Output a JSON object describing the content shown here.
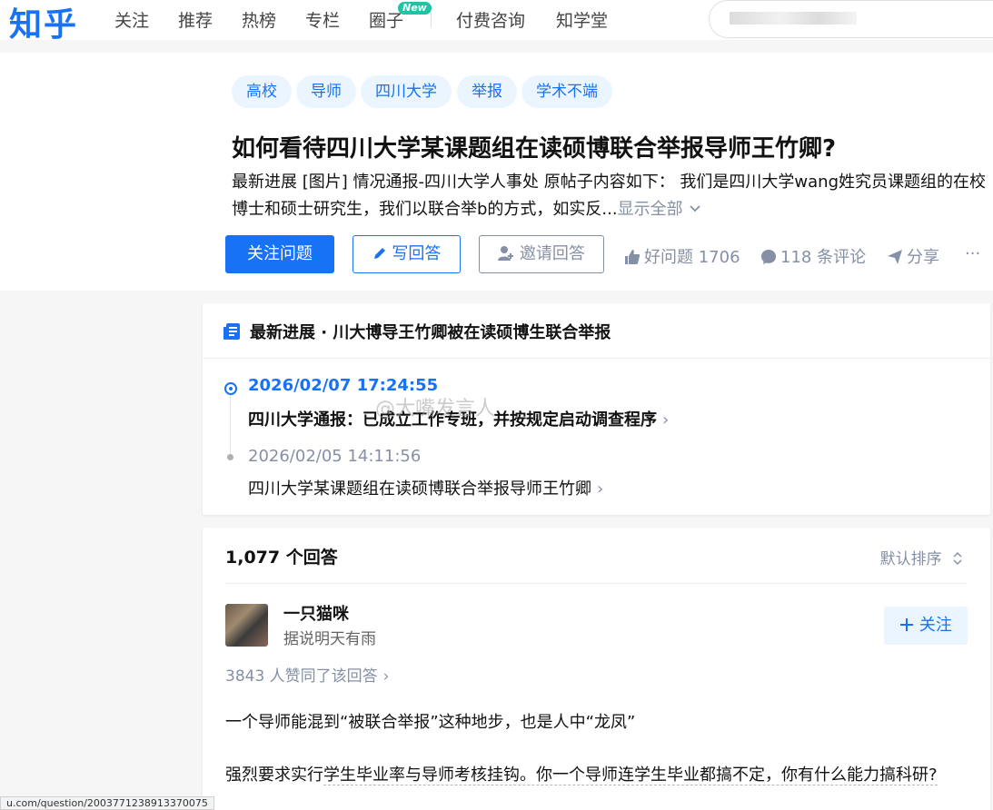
{
  "nav": {
    "logo": "知乎",
    "items": [
      "关注",
      "推荐",
      "热榜",
      "专栏",
      "圈子",
      "付费咨询",
      "知学堂"
    ],
    "new_badge": "New"
  },
  "question": {
    "tags": [
      "高校",
      "导师",
      "四川大学",
      "举报",
      "学术不端"
    ],
    "title": "如何看待四川大学某课题组在读硕博联合举报导师王竹卿?",
    "desc": "最新进展 [图片] 情况通报-四川大学人事处 原帖子内容如下： 我们是四川大学wang姓究员课题组的在校博士和硕士研究生，我们以联合举b的方式，如实反...",
    "show_all": "显示全部",
    "follow_btn": "关注问题",
    "answer_btn": "写回答",
    "invite_btn": "邀请回答",
    "good_question": "好问题 1706",
    "comments": "118 条评论",
    "share": "分享",
    "more": "···"
  },
  "progress": {
    "header": "最新进展 · 川大博导王竹卿被在读硕博生联合举报",
    "items": [
      {
        "time": "2026/02/07 17:24:55",
        "title": "四川大学通报：已成立工作专班，并按规定启动调查程序"
      },
      {
        "time": "2026/02/05 14:11:56",
        "title": "四川大学某课题组在读硕博联合举报导师王竹卿"
      }
    ],
    "watermark": "@大嘴发言人"
  },
  "answers": {
    "count": "1,077 个回答",
    "sort": "默认排序",
    "author": "一只猫咪",
    "bio": "据说明天有雨",
    "follow": "关注",
    "upvotes": "3843 人赞同了该回答",
    "para1": "一个导师能混到“被联合举报”这种地步，也是人中“龙凤”",
    "para2_a": "强烈要求实行",
    "para2_b": "学生毕业率与导师考核挂钩。你一个导师连学生毕业都搞不定，你有什么能力搞科研?"
  },
  "status_url": "u.com/question/2003771238913370075",
  "colors": {
    "brand": "#1772f6",
    "muted": "#8590a6"
  }
}
